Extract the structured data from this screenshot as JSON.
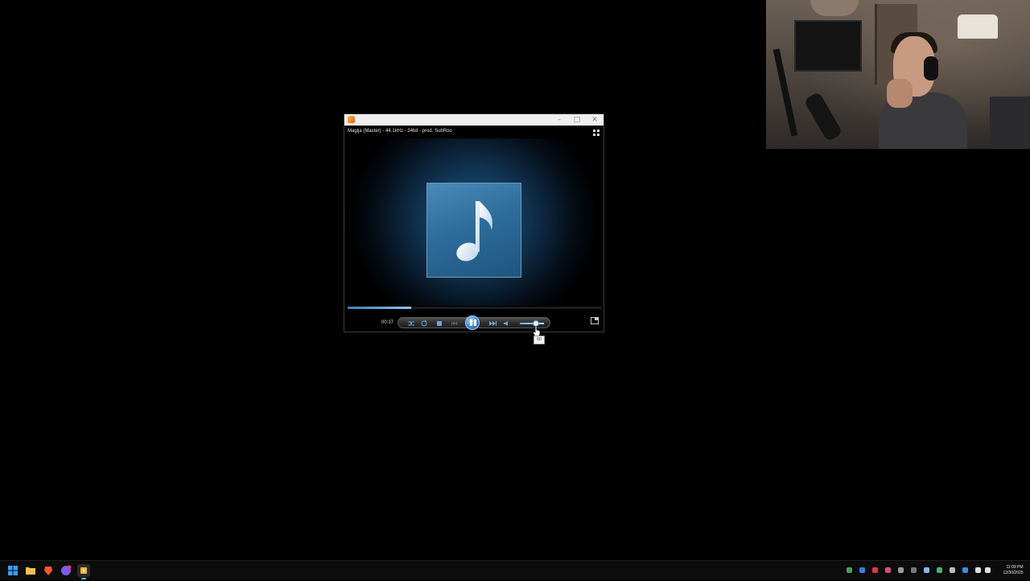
{
  "player": {
    "now_playing_title": "Magija (Master) - 44.1kHz - 24bit - prod. SubRoo",
    "time_elapsed": "00:37",
    "progress_fraction": 0.25,
    "volume_fraction": 0.6,
    "state": "playing",
    "volume_tooltip": "60",
    "window_controls": {
      "minimize": "–",
      "maximize": "□",
      "close": "✕"
    },
    "colors": {
      "accent": "#4a93d6",
      "album_bg": "#2e6d9c",
      "titlebar": "#efefef"
    }
  },
  "icons": {
    "app": "media-player-icon",
    "view": "view-toggle-icon",
    "shuffle": "shuffle-icon",
    "repeat": "repeat-icon",
    "stop": "stop-icon",
    "previous": "previous-icon",
    "play_pause": "pause-icon",
    "next": "next-icon",
    "mute": "speaker-icon",
    "library": "switch-to-library-icon"
  },
  "taskbar": {
    "clock_time": "11:09 PM",
    "clock_date": "12/30/2025",
    "apps": [
      "start-icon",
      "file-explorer-icon",
      "brave-browser-icon",
      "chat-app-icon",
      "media-player-icon"
    ]
  }
}
